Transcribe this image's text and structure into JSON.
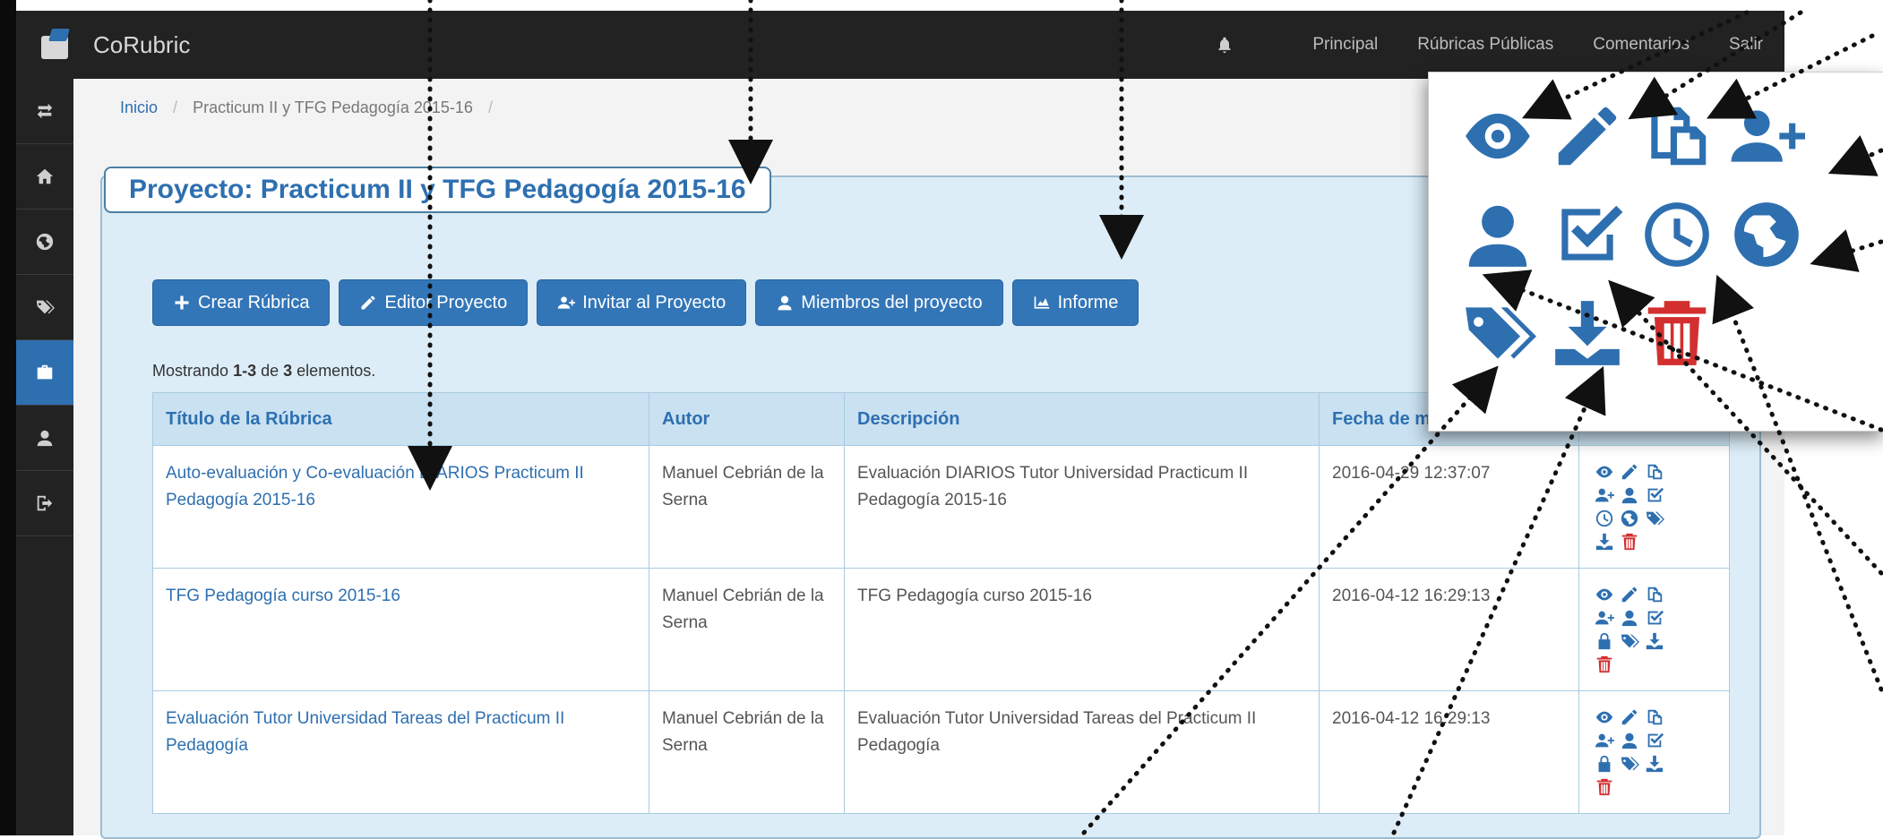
{
  "navbar": {
    "brand": "CoRubric",
    "links": [
      "Principal",
      "Rúbricas Públicas",
      "Comentarios",
      "Salir"
    ]
  },
  "sidebar": {
    "icons": [
      "swap-icon",
      "home-icon",
      "globe-icon",
      "tags-icon",
      "briefcase-icon",
      "user-icon",
      "logout-icon"
    ],
    "active_index": 4
  },
  "breadcrumb": {
    "home": "Inicio",
    "current": "Practicum II y TFG Pedagogía 2015-16"
  },
  "project": {
    "title": "Proyecto: Practicum II y TFG Pedagogía 2015-16"
  },
  "toolbar": {
    "create": "Crear Rúbrica",
    "edit": "Editor Proyecto",
    "invite": "Invitar al Proyecto",
    "members": "Miembros del proyecto",
    "report": "Informe"
  },
  "summary": {
    "prefix": "Mostrando",
    "range": "1-3",
    "middle": "de",
    "total": "3",
    "suffix": "elementos."
  },
  "table": {
    "columns": [
      "Título de la Rúbrica",
      "Autor",
      "Descripción",
      "Fecha de m"
    ],
    "rows": [
      {
        "title": "Auto-evaluación y Co-evaluación DIARIOS Practicum II Pedagogía 2015-16",
        "author": "Manuel Cebrián de la Serna",
        "description": "Evaluación DIARIOS Tutor Universidad Practicum II Pedagogía 2015-16",
        "date": "2016-04-29 12:37:07",
        "actions": [
          "eye-icon",
          "pencil-icon",
          "copy-icon",
          "user-plus-icon",
          "user-icon",
          "check-square-icon",
          "clock-icon",
          "globe-icon",
          "tags-icon",
          "download-icon",
          "trash-icon"
        ]
      },
      {
        "title": "TFG Pedagogía curso 2015-16",
        "author": "Manuel Cebrián de la Serna",
        "description": "TFG Pedagogía curso 2015-16",
        "date": "2016-04-12 16:29:13",
        "actions": [
          "eye-icon",
          "pencil-icon",
          "copy-icon",
          "user-plus-icon",
          "user-icon",
          "check-square-icon",
          "lock-icon",
          "tags-icon",
          "download-icon",
          "trash-icon"
        ]
      },
      {
        "title": "Evaluación Tutor Universidad Tareas del Practicum II Pedagogía",
        "author": "Manuel Cebrián de la Serna",
        "description": "Evaluación Tutor Universidad Tareas del Practicum II Pedagogía",
        "date": "2016-04-12 16:29:13",
        "actions": [
          "eye-icon",
          "pencil-icon",
          "copy-icon",
          "user-plus-icon",
          "user-icon",
          "check-square-icon",
          "lock-icon",
          "tags-icon",
          "download-icon",
          "trash-icon"
        ]
      }
    ]
  },
  "popup": {
    "icons": [
      "eye-icon",
      "pencil-icon",
      "copy-icon",
      "user-plus-icon",
      "user-icon",
      "check-square-icon",
      "clock-icon",
      "globe-icon",
      "tags-icon",
      "download-icon",
      "trash-icon"
    ]
  },
  "colors": {
    "primary": "#3376b8",
    "navbar": "#222222",
    "panel": "#dcedf7",
    "danger": "#d32f2f"
  }
}
